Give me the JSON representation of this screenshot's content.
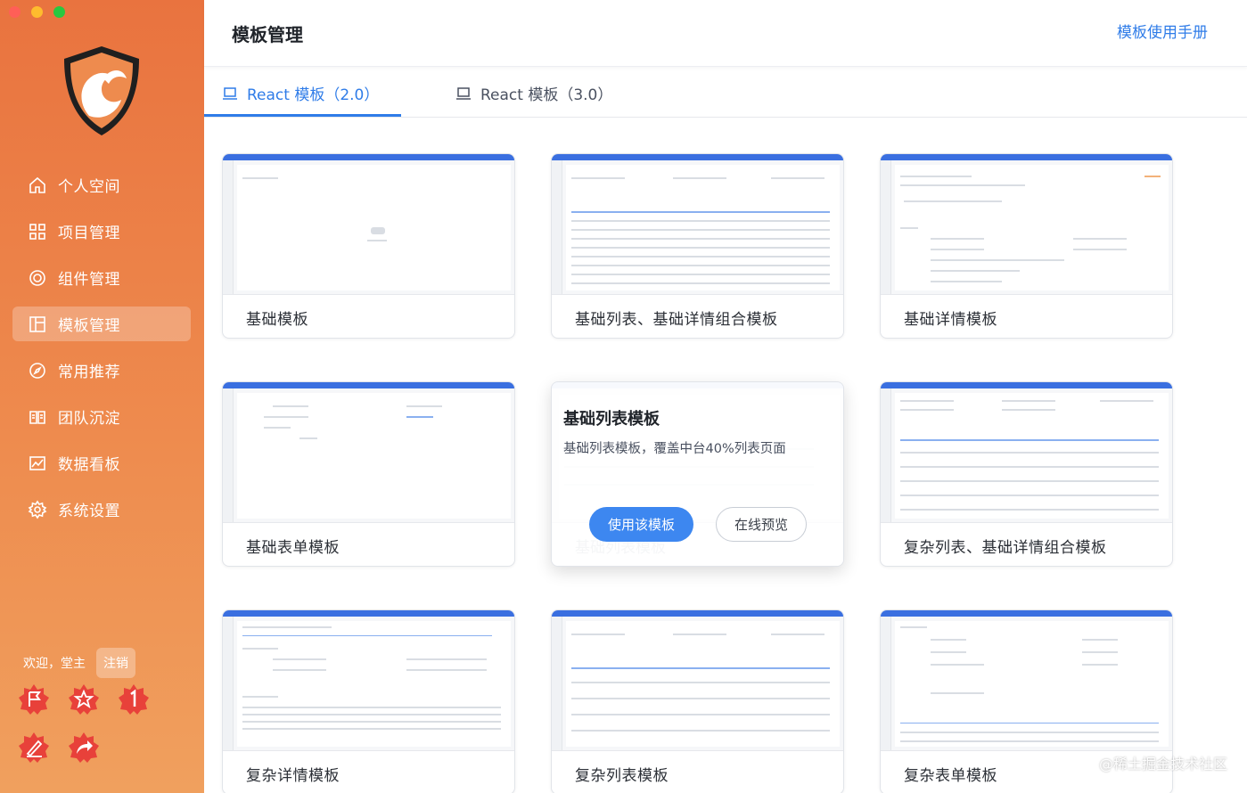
{
  "window": {
    "traffic_lights": [
      "#ff5f57",
      "#febc2e",
      "#28c840"
    ]
  },
  "sidebar": {
    "items": [
      {
        "label": "个人空间",
        "icon": "home-icon"
      },
      {
        "label": "项目管理",
        "icon": "grid-icon"
      },
      {
        "label": "组件管理",
        "icon": "component-icon"
      },
      {
        "label": "模板管理",
        "icon": "template-icon",
        "active": true
      },
      {
        "label": "常用推荐",
        "icon": "compass-icon"
      },
      {
        "label": "团队沉淀",
        "icon": "book-icon"
      },
      {
        "label": "数据看板",
        "icon": "chart-icon"
      },
      {
        "label": "系统设置",
        "icon": "gear-icon"
      }
    ],
    "welcome": "欢迎，堂主",
    "logout": "注销",
    "badge_icons": [
      "flag-badge-icon",
      "star-badge-icon",
      "number-one-badge-icon",
      "pen-badge-icon",
      "share-badge-icon"
    ]
  },
  "header": {
    "title": "模板管理",
    "manual_link": "模板使用手册"
  },
  "tabs": [
    {
      "label": "React 模板（2.0）",
      "active": true
    },
    {
      "label": "React 模板（3.0）",
      "active": false
    }
  ],
  "cards": [
    {
      "title": "基础模板"
    },
    {
      "title": "基础列表、基础详情组合模板"
    },
    {
      "title": "基础详情模板"
    },
    {
      "title": "基础表单模板"
    },
    {
      "title": "基础列表模板",
      "description": "基础列表模板，覆盖中台40%列表页面",
      "use_button": "使用该模板",
      "preview_button": "在线预览",
      "hovered": true
    },
    {
      "title": "复杂列表、基础详情组合模板"
    },
    {
      "title": "复杂详情模板"
    },
    {
      "title": "复杂列表模板"
    },
    {
      "title": "复杂表单模板"
    }
  ],
  "watermark": "@稀土掘金技术社区",
  "colors": {
    "accent": "#2f7ce8",
    "sidebar": "#ee8b4e",
    "badge": "#e8413a"
  }
}
